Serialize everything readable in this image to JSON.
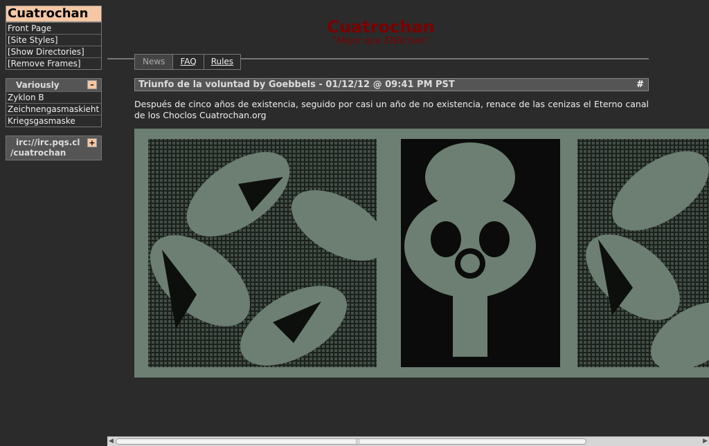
{
  "sidebar": {
    "site_title": "Cuatrochan",
    "links": [
      "Front Page",
      "[Site Styles]",
      "[Show Directories]",
      "[Remove Frames]"
    ],
    "section": {
      "title": "Variously",
      "toggle": "–",
      "items": [
        "Zyklon B",
        "Zeichnengasmaskieht",
        "Kriegsgasmaske"
      ]
    },
    "irc": {
      "line1": "irc://irc.pqs.cl",
      "line2": "/cuatrochan",
      "toggle": "+"
    }
  },
  "header": {
    "title": "Cuatrochan",
    "subtitle": "\"Mejor que ENRchan\""
  },
  "tabs": [
    {
      "label": "News",
      "active": true
    },
    {
      "label": "FAQ",
      "active": false
    },
    {
      "label": "Rules",
      "active": false
    }
  ],
  "post": {
    "heading": "Triunfo de la voluntad by Goebbels - 01/12/12 @ 09:41 PM PST",
    "permalink": "#",
    "body": "Después de cinco años de existencia, seguido por casi un año de no existencia, renace de las cenizas el Eterno canal de los Choclos Cuatrochan.org"
  },
  "colors": {
    "accent": "#f5c7a4",
    "title_red": "#7a0000",
    "image_bg": "#6c7f72"
  }
}
